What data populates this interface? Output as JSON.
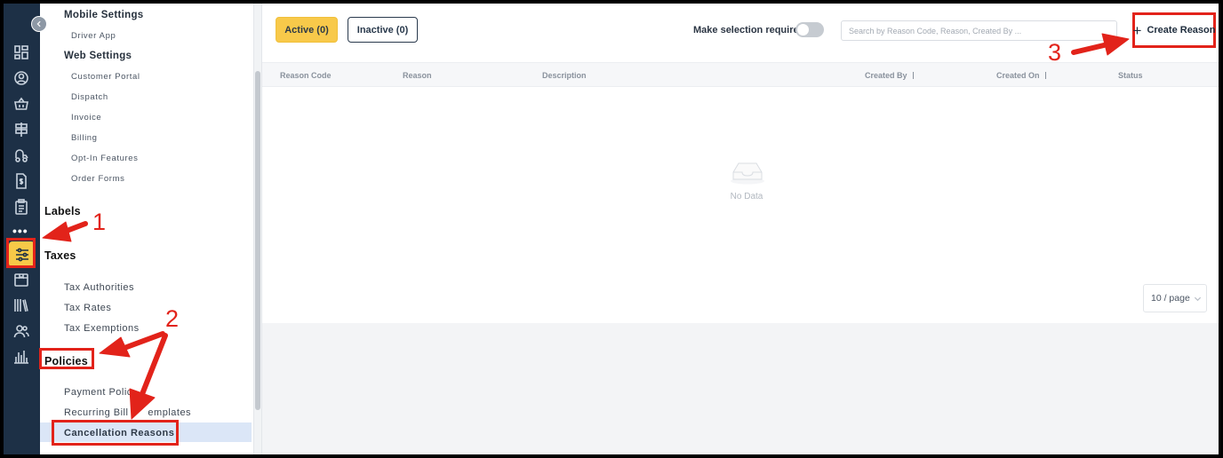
{
  "nav": {
    "mobile_settings": "Mobile Settings",
    "driver_app": "Driver App",
    "web_settings": "Web Settings",
    "customer_portal": "Customer Portal",
    "dispatch": "Dispatch",
    "invoice": "Invoice",
    "billing": "Billing",
    "opt_in": "Opt-In Features",
    "order_forms": "Order Forms",
    "labels": "Labels",
    "taxes": "Taxes",
    "tax_authorities": "Tax Authorities",
    "tax_rates": "Tax Rates",
    "tax_exemptions": "Tax Exemptions",
    "policies": "Policies",
    "payment_policies": "Payment Polic",
    "recurring_billing": "Recurring Bill",
    "recurring_billing_tail": "emplates",
    "cancellation_reasons": "Cancellation Reasons"
  },
  "rail": {
    "icons": [
      "dashboard-icon",
      "user-circle-icon",
      "basket-icon",
      "signpost-icon",
      "truck-icon",
      "invoice-dollar-icon",
      "clipboard-icon",
      "more-icon",
      "settings-sliders-icon",
      "package-icon",
      "books-icon",
      "users-icon",
      "bar-chart-icon"
    ],
    "more_label": "•••"
  },
  "toolbar": {
    "active_tab": "Active (0)",
    "inactive_tab": "Inactive (0)",
    "toggle_label": "Make selection required",
    "toggle_on": false,
    "search_placeholder": "Search by Reason Code, Reason, Created By ...",
    "create_label": "Create Reason"
  },
  "table": {
    "columns": [
      "Reason Code",
      "Reason",
      "Description",
      "Created By",
      "Created On",
      "Status"
    ],
    "empty_text": "No Data"
  },
  "pagination": {
    "page_size": "10 / page"
  },
  "annotations": {
    "step1": "1",
    "step2": "2",
    "step3": "3",
    "color": "#e2231a"
  }
}
